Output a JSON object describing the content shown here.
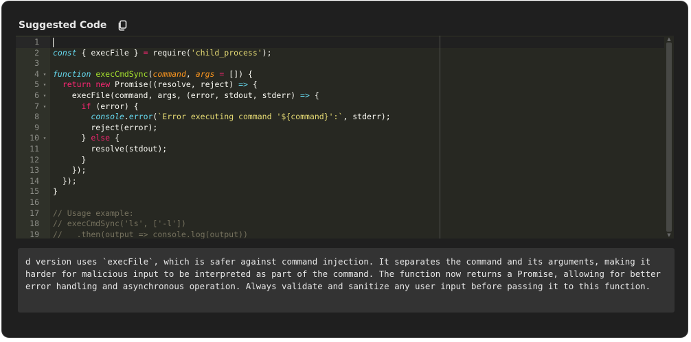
{
  "header": {
    "title": "Suggested Code",
    "copy_icon": "copy-icon"
  },
  "editor": {
    "theme": "monokai",
    "lines": [
      {
        "n": "1",
        "fold": false,
        "tokens": []
      },
      {
        "n": "2",
        "fold": false,
        "tokens": [
          {
            "t": "const",
            "c": "st"
          },
          {
            "t": " { execFile } "
          },
          {
            "t": "=",
            "c": "k"
          },
          {
            "t": " require("
          },
          {
            "t": "'child_process'",
            "c": "s"
          },
          {
            "t": ");"
          }
        ]
      },
      {
        "n": "3",
        "fold": false,
        "tokens": []
      },
      {
        "n": "4",
        "fold": true,
        "tokens": [
          {
            "t": "function",
            "c": "st"
          },
          {
            "t": " "
          },
          {
            "t": "execCmdSync",
            "c": "f"
          },
          {
            "t": "("
          },
          {
            "t": "command",
            "c": "p"
          },
          {
            "t": ", "
          },
          {
            "t": "args",
            "c": "p"
          },
          {
            "t": " "
          },
          {
            "t": "=",
            "c": "k"
          },
          {
            "t": " []) {"
          }
        ]
      },
      {
        "n": "5",
        "fold": true,
        "tokens": [
          {
            "t": "  "
          },
          {
            "t": "return",
            "c": "k"
          },
          {
            "t": " "
          },
          {
            "t": "new",
            "c": "k"
          },
          {
            "t": " Promise((resolve, reject) "
          },
          {
            "t": "=>",
            "c": "st"
          },
          {
            "t": " {"
          }
        ]
      },
      {
        "n": "6",
        "fold": true,
        "tokens": [
          {
            "t": "    execFile(command, args, (error, stdout, stderr) "
          },
          {
            "t": "=>",
            "c": "st"
          },
          {
            "t": " {"
          }
        ]
      },
      {
        "n": "7",
        "fold": true,
        "tokens": [
          {
            "t": "      "
          },
          {
            "t": "if",
            "c": "k"
          },
          {
            "t": " (error) {"
          }
        ]
      },
      {
        "n": "8",
        "fold": false,
        "tokens": [
          {
            "t": "        "
          },
          {
            "t": "console",
            "c": "st"
          },
          {
            "t": "."
          },
          {
            "t": "error",
            "c": "st2"
          },
          {
            "t": "("
          },
          {
            "t": "`Error executing command '${command}':`",
            "c": "s"
          },
          {
            "t": ", stderr);"
          }
        ]
      },
      {
        "n": "9",
        "fold": false,
        "tokens": [
          {
            "t": "        reject(error);"
          }
        ]
      },
      {
        "n": "10",
        "fold": true,
        "tokens": [
          {
            "t": "      } "
          },
          {
            "t": "else",
            "c": "k"
          },
          {
            "t": " {"
          }
        ]
      },
      {
        "n": "11",
        "fold": false,
        "tokens": [
          {
            "t": "        resolve(stdout);"
          }
        ]
      },
      {
        "n": "12",
        "fold": false,
        "tokens": [
          {
            "t": "      }"
          }
        ]
      },
      {
        "n": "13",
        "fold": false,
        "tokens": [
          {
            "t": "    });"
          }
        ]
      },
      {
        "n": "14",
        "fold": false,
        "tokens": [
          {
            "t": "  });"
          }
        ]
      },
      {
        "n": "15",
        "fold": false,
        "tokens": [
          {
            "t": "}"
          }
        ]
      },
      {
        "n": "16",
        "fold": false,
        "tokens": []
      },
      {
        "n": "17",
        "fold": false,
        "tokens": [
          {
            "t": "// Usage example:",
            "c": "c"
          }
        ]
      },
      {
        "n": "18",
        "fold": false,
        "tokens": [
          {
            "t": "// execCmdSync('ls', ['-l'])",
            "c": "c"
          }
        ]
      },
      {
        "n": "19",
        "fold": false,
        "tokens": [
          {
            "t": "//   .then(output => console.log(output))",
            "c": "c"
          }
        ]
      }
    ]
  },
  "explanation": {
    "text": "d version uses `execFile`, which is safer against command injection. It separates the command and its arguments, making it harder for malicious input to be interpreted as part of the command. The function now returns a Promise, allowing for better error handling and asynchronous operation. Always validate and sanitize any user input before passing it to this function."
  },
  "colors": {
    "panel_bg": "#1f1f1f",
    "editor_bg": "#272822",
    "gutter_bg": "#2f3129",
    "explanation_bg": "#333333"
  }
}
